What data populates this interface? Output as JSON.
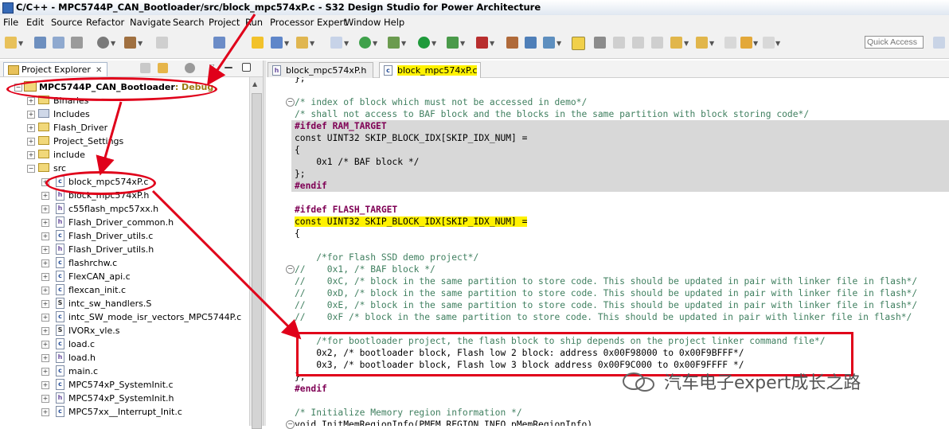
{
  "window": {
    "title": "C/C++ - MPC5744P_CAN_Bootloader/src/block_mpc574xP.c - S32 Design Studio for Power Architecture"
  },
  "menu": [
    "File",
    "Edit",
    "Source",
    "Refactor",
    "Navigate",
    "Search",
    "Project",
    "Run",
    "Processor Expert",
    "Window",
    "Help"
  ],
  "toolbar": {
    "quick_access_placeholder": "Quick Access"
  },
  "project_explorer": {
    "tab_label": "Project Explorer",
    "close_glyph": "✕",
    "project_name": "MPC5744P_CAN_Bootloader",
    "project_config": ": Debug",
    "items": [
      {
        "label": "Binaries",
        "type": "folder",
        "expanded": false
      },
      {
        "label": "Includes",
        "type": "folder",
        "expanded": false
      },
      {
        "label": "Flash_Driver",
        "type": "folder",
        "expanded": false
      },
      {
        "label": "Project_Settings",
        "type": "folder",
        "expanded": false
      },
      {
        "label": "include",
        "type": "folder",
        "expanded": false
      },
      {
        "label": "src",
        "type": "folder",
        "expanded": true
      }
    ],
    "src_files": [
      {
        "label": "block_mpc574xP.c",
        "type": "c"
      },
      {
        "label": "block_mpc574xP.h",
        "type": "h"
      },
      {
        "label": "c55flash_mpc57xx.h",
        "type": "h"
      },
      {
        "label": "Flash_Driver_common.h",
        "type": "h"
      },
      {
        "label": "Flash_Driver_utils.c",
        "type": "c"
      },
      {
        "label": "Flash_Driver_utils.h",
        "type": "h"
      },
      {
        "label": "flashrchw.c",
        "type": "c"
      },
      {
        "label": "FlexCAN_api.c",
        "type": "c"
      },
      {
        "label": "flexcan_init.c",
        "type": "c"
      },
      {
        "label": "intc_sw_handlers.S",
        "type": "s"
      },
      {
        "label": "intc_SW_mode_isr_vectors_MPC5744P.c",
        "type": "c"
      },
      {
        "label": "IVORx_vle.s",
        "type": "s"
      },
      {
        "label": "load.c",
        "type": "c"
      },
      {
        "label": "load.h",
        "type": "h"
      },
      {
        "label": "main.c",
        "type": "c"
      },
      {
        "label": "MPC574xP_SystemInit.c",
        "type": "c"
      },
      {
        "label": "MPC574xP_SystemInit.h",
        "type": "h"
      },
      {
        "label": "MPC57xx__Interrupt_Init.c",
        "type": "c"
      }
    ]
  },
  "editor": {
    "tabs": [
      {
        "label": "block_mpc574xP.h",
        "active": false
      },
      {
        "label": "block_mpc574xP.c",
        "active": true
      }
    ],
    "lines": [
      {
        "text": "};",
        "cls": ""
      },
      {
        "text": "",
        "cls": ""
      },
      {
        "text": "/* index of block which must not be accessed in demo*/",
        "cls": "cm"
      },
      {
        "text": "/* shall not access to BAF block and the blocks in the same partition with block storing code*/",
        "cls": "cm"
      },
      {
        "text": "#ifdef RAM_TARGET",
        "cls": "pp",
        "shade": true
      },
      {
        "text": "const UINT32 SKIP_BLOCK_IDX[SKIP_IDX_NUM] =",
        "cls": "",
        "shade": true
      },
      {
        "text": "{",
        "cls": "",
        "shade": true
      },
      {
        "text": "    0x1 /* BAF block */",
        "cls": "",
        "shade": true
      },
      {
        "text": "};",
        "cls": "",
        "shade": true
      },
      {
        "text": "#endif",
        "cls": "pp",
        "shade": true
      },
      {
        "text": "",
        "cls": ""
      },
      {
        "text": "#ifdef FLASH_TARGET",
        "cls": "pp"
      },
      {
        "text": "const UINT32 SKIP_BLOCK_IDX[SKIP_IDX_NUM] =",
        "cls": ""
      },
      {
        "text": "{",
        "cls": ""
      },
      {
        "text": "",
        "cls": ""
      },
      {
        "text": "    /*for Flash SSD demo project*/",
        "cls": "cm"
      },
      {
        "text": "//    0x1, /* BAF block */",
        "cls": "cm"
      },
      {
        "text": "//    0xC, /* block in the same partition to store code. This should be updated in pair with linker file in flash*/",
        "cls": "cm"
      },
      {
        "text": "//    0xD, /* block in the same partition to store code. This should be updated in pair with linker file in flash*/",
        "cls": "cm"
      },
      {
        "text": "//    0xE, /* block in the same partition to store code. This should be updated in pair with linker file in flash*/",
        "cls": "cm"
      },
      {
        "text": "//    0xF /* block in the same partition to store code. This should be updated in pair with linker file in flash*/",
        "cls": "cm"
      },
      {
        "text": "",
        "cls": ""
      },
      {
        "text": "    /*for bootloader project, the flash block to ship depends on the project linker command file*/",
        "cls": "cm"
      },
      {
        "text": "    0x2, /* bootloader block, Flash low 2 block: address 0x00F98000 to 0x00F9BFFF*/",
        "cls": ""
      },
      {
        "text": "    0x3, /* bootloader block, Flash low 3 block address 0x00F9C000 to 0x00F9FFFF */",
        "cls": ""
      },
      {
        "text": "};",
        "cls": ""
      },
      {
        "text": "#endif",
        "cls": "pp"
      },
      {
        "text": "",
        "cls": ""
      },
      {
        "text": "/* Initialize Memory region information */",
        "cls": "cm"
      },
      {
        "text": "void InitMemRegionInfo(PMEM_REGION_INFO pMemRegionInfo)",
        "cls": ""
      }
    ]
  },
  "watermark": "汽车电子expert成长之路",
  "colors": {
    "highlight_yellow": "#fff200",
    "annotation_red": "#e0001a",
    "comment_green": "#3f7f5f",
    "keyword_purple": "#7f0055"
  }
}
